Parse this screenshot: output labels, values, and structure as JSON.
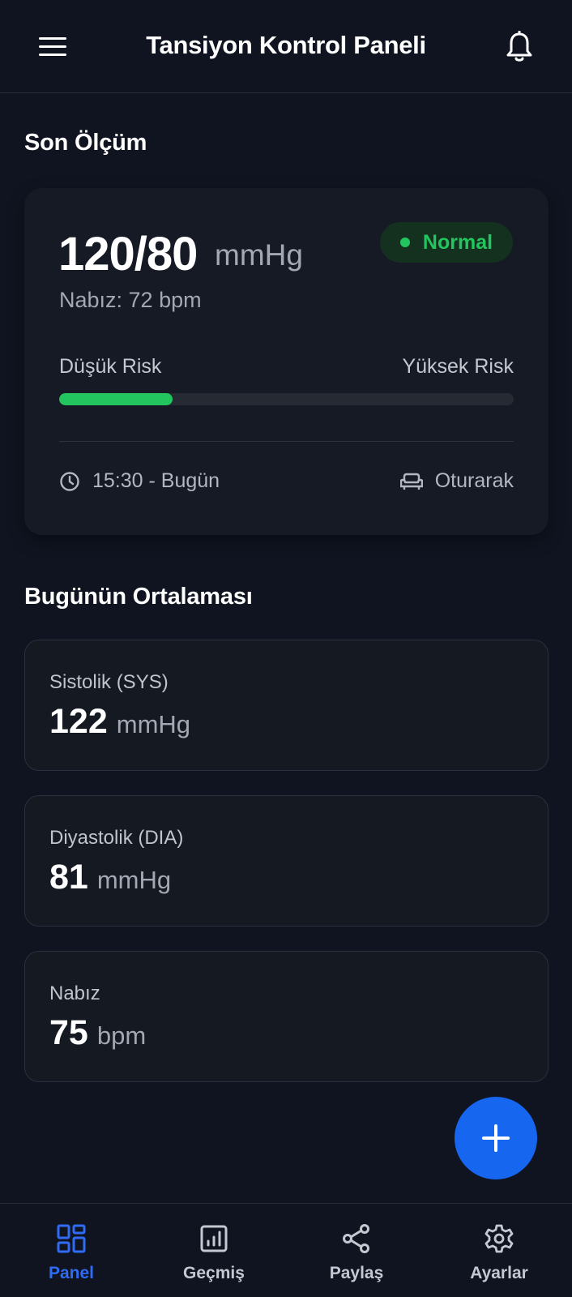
{
  "header": {
    "title": "Tansiyon Kontrol Paneli",
    "menu_icon": "hamburger-menu-icon",
    "notification_icon": "bell-icon"
  },
  "last_measurement": {
    "section_title": "Son Ölçüm",
    "blood_pressure": "120/80",
    "unit": "mmHg",
    "pulse_text": "Nabız: 72 bpm",
    "status": "Normal",
    "status_color": "#22c55e",
    "risk_low_label": "Düşük Risk",
    "risk_high_label": "Yüksek Risk",
    "risk_level_percent": 25,
    "time_text": "15:30 - Bugün",
    "position_text": "Oturarak"
  },
  "today_average": {
    "section_title": "Bugünün Ortalaması",
    "cards": [
      {
        "label": "Sistolik (SYS)",
        "value": "122",
        "unit": "mmHg"
      },
      {
        "label": "Diyastolik (DIA)",
        "value": "81",
        "unit": "mmHg"
      },
      {
        "label": "Nabız",
        "value": "75",
        "unit": "bpm"
      }
    ]
  },
  "fab": {
    "icon": "plus-icon",
    "color": "#1766f0"
  },
  "bottom_nav": {
    "active_color": "#2f6bf5",
    "items": [
      {
        "label": "Panel",
        "icon": "dashboard-icon",
        "active": true
      },
      {
        "label": "Geçmiş",
        "icon": "chart-icon",
        "active": false
      },
      {
        "label": "Paylaş",
        "icon": "share-icon",
        "active": false
      },
      {
        "label": "Ayarlar",
        "icon": "gear-icon",
        "active": false
      }
    ]
  }
}
